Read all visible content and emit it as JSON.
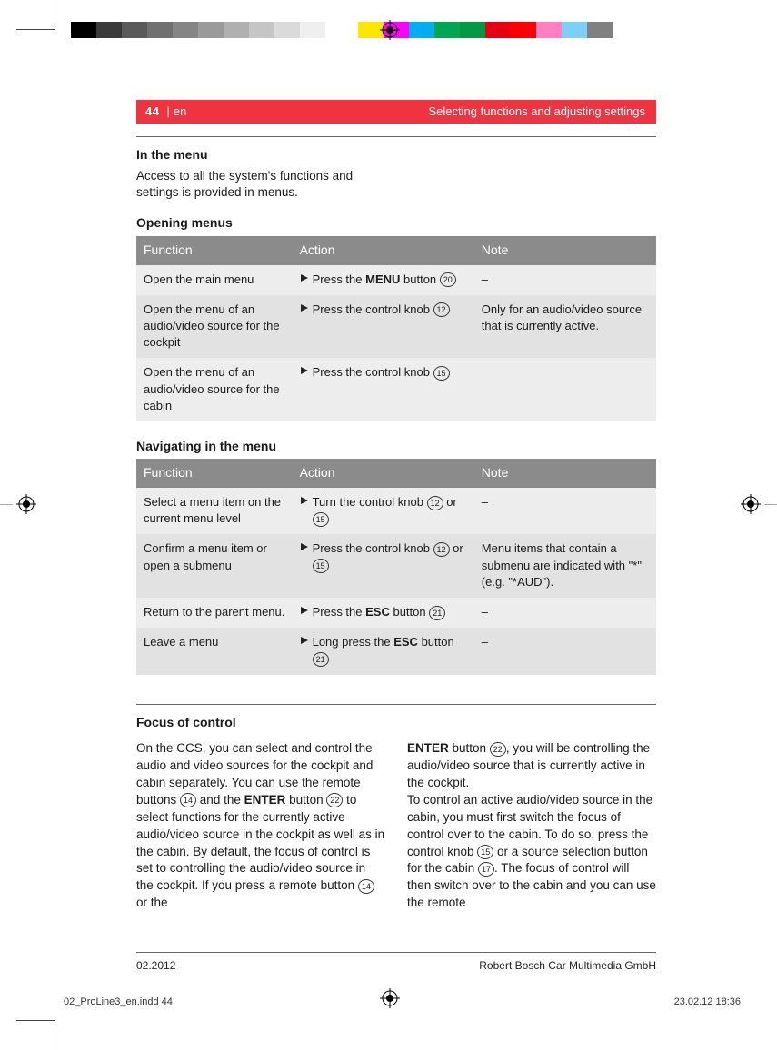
{
  "colorbar": [
    "#000000",
    "#3a3a3a",
    "#5a5a5a",
    "#707070",
    "#858585",
    "#9a9a9a",
    "#b0b0b0",
    "#c5c5c5",
    "#dadada",
    "#efefef",
    "#ffffff",
    "gap",
    "#ffe600",
    "#ff00ff",
    "#00aeef",
    "#00a651",
    "#009944",
    "#e60012",
    "#ff0000",
    "#ff80c0",
    "#7ecff5",
    "#808080"
  ],
  "header": {
    "page_num": "44",
    "sep": "|",
    "lang": "en",
    "title": "Selecting functions and adjusting settings"
  },
  "section_in_menu": {
    "heading": "In the menu",
    "body": "Access to all the system's functions and settings is provided in menus."
  },
  "opening_menus": {
    "heading": "Opening menus",
    "headers": {
      "f": "Function",
      "a": "Action",
      "n": "Note"
    },
    "rows": [
      {
        "f": "Open the main menu",
        "a_pre": "Press the ",
        "a_b": "MENU",
        "a_post": " button ",
        "a_ref": "20",
        "n": "–"
      },
      {
        "f": "Open the menu of an audio/video source for the cockpit",
        "a_pre": "Press the control knob ",
        "a_b": "",
        "a_post": "",
        "a_ref": "12",
        "n": "Only for an audio/video source that is currently active."
      },
      {
        "f": "Open the menu of an audio/video source for the cabin",
        "a_pre": "Press the control knob ",
        "a_b": "",
        "a_post": "",
        "a_ref": "15",
        "n": ""
      }
    ]
  },
  "navigating": {
    "heading": "Navigating in the menu",
    "headers": {
      "f": "Function",
      "a": "Action",
      "n": "Note"
    },
    "rows": [
      {
        "f": "Select a menu item on the current menu level",
        "a_pre": "Turn the control knob ",
        "a_ref": "12",
        "a_mid": " or ",
        "a_ref2": "15",
        "a_b": "",
        "a_post": "",
        "n": "–"
      },
      {
        "f": "Confirm a menu item or open a submenu",
        "a_pre": "Press the control knob ",
        "a_ref": "12",
        "a_mid": " or ",
        "a_ref2": "15",
        "a_b": "",
        "a_post": "",
        "n": "Menu items that contain a submenu are indicated with \"*\" (e.g. \"*AUD\")."
      },
      {
        "f": "Return to the parent menu.",
        "a_pre": "Press the ",
        "a_b": "ESC",
        "a_post": " button ",
        "a_ref": "21",
        "a_mid": "",
        "a_ref2": "",
        "n": "–"
      },
      {
        "f": "Leave a menu",
        "a_pre": "Long press the ",
        "a_b": "ESC",
        "a_post": " button ",
        "a_ref": "21",
        "a_mid": "",
        "a_ref2": "",
        "n": "–"
      }
    ]
  },
  "focus": {
    "heading": "Focus of control",
    "left_parts": [
      {
        "t": "On the CCS, you can select and control the audio and video sources for the cockpit and cabin separately. You can use the remote buttons "
      },
      {
        "ref": "14"
      },
      {
        "t": " and the "
      },
      {
        "b": "ENTER"
      },
      {
        "t": " button "
      },
      {
        "ref": "22"
      },
      {
        "t": " to select functions for the currently active audio/video source in the cockpit as well as in the cabin. By default, the focus of control is set to controlling the audio/video source in the cockpit. If you press a remote button "
      },
      {
        "ref": "14"
      },
      {
        "t": " or the"
      }
    ],
    "right_parts": [
      {
        "b": "ENTER"
      },
      {
        "t": " button "
      },
      {
        "ref": "22"
      },
      {
        "t": ", you will be controlling the audio/video source that is currently active in the cockpit."
      },
      {
        "br": true
      },
      {
        "t": "To control an active audio/video source in the cabin, you must first switch the focus of control over to the cabin. To do so, press the control knob "
      },
      {
        "ref": "15"
      },
      {
        "t": " or a source selection button for the cabin "
      },
      {
        "ref": "17"
      },
      {
        "t": ". The focus of control will then switch over to the cabin and you can use the remote"
      }
    ]
  },
  "footer": {
    "left": "02.2012",
    "right": "Robert Bosch Car Multimedia GmbH"
  },
  "slug": {
    "left": "02_ProLine3_en.indd   44",
    "right": "23.02.12   18:36"
  }
}
